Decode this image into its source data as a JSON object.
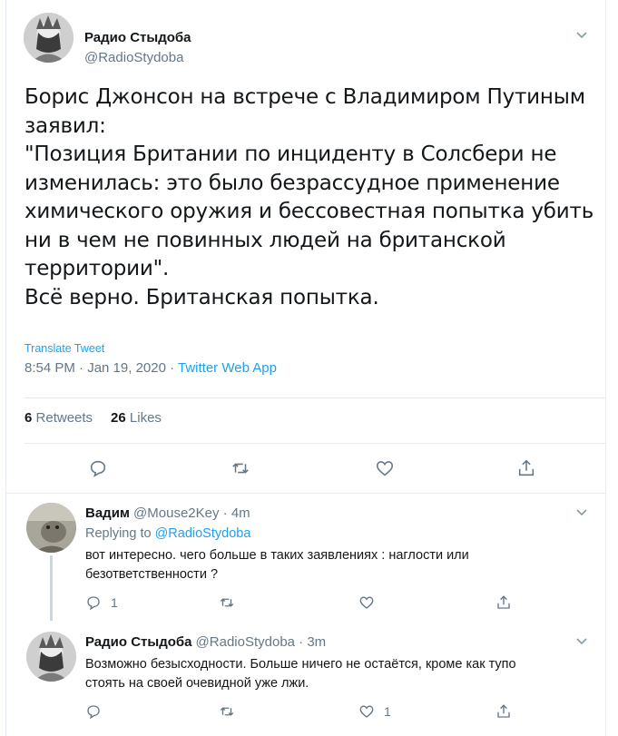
{
  "main_tweet": {
    "display_name": "Радио Стыдоба",
    "handle": "@RadioStydoba",
    "body_lines": [
      "Борис Джонсон на встрече с Владимиром Путиным",
      "заявил:",
      "\"Позиция Британии по инциденту в Солсбери не",
      "изменилась: это было безрассудное применение",
      "химического оружия и бессовестная попытка убить",
      "ни в чем не повинных людей на британской",
      "территории\".",
      "Всё верно. Британская попытка."
    ],
    "translate_label": "Translate Tweet",
    "time": "8:54 PM · Jan 19, 2020 · ",
    "source": "Twitter Web App",
    "retweets_count": "6",
    "retweets_label": "Retweets",
    "likes_count": "26",
    "likes_label": "Likes"
  },
  "replies": [
    {
      "display_name": "Вадим",
      "handle_time": "@Mouse2Key · 4m",
      "replying_prefix": "Replying to ",
      "replying_to": "@RadioStydoba",
      "body_lines": [
        "вот интересно. чего больше в таких заявлениях : наглости или",
        "безответственности ?"
      ],
      "reply_count": "1",
      "retweet_count": "",
      "like_count": ""
    },
    {
      "display_name": "Радио Стыдоба",
      "handle_time": "@RadioStydoba · 3m",
      "body_lines": [
        "Возможно безысходности. Больше ничего не остаётся, кроме как тупо",
        "стоять на своей очевидной уже лжи."
      ],
      "reply_count": "",
      "retweet_count": "",
      "like_count": "1"
    }
  ],
  "icons": [
    "reply-icon",
    "retweet-icon",
    "like-icon",
    "share-icon",
    "chevron-down-icon"
  ],
  "colors": {
    "accent": "#1da1f2",
    "secondary_text": "#657786",
    "border": "#e6ecf0"
  }
}
